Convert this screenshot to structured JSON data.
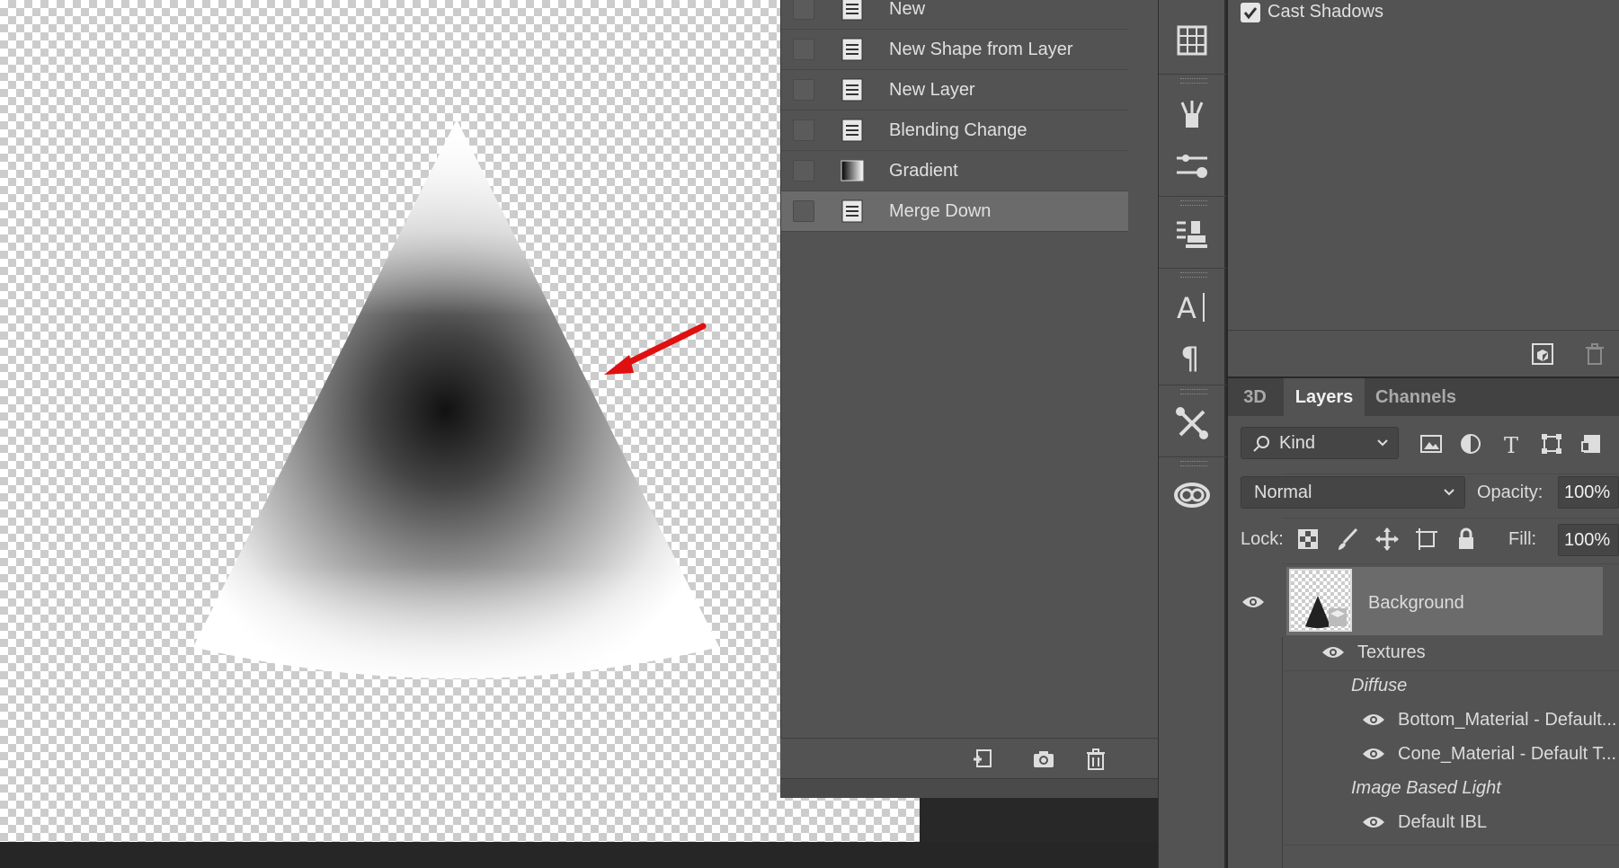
{
  "history": {
    "items": [
      {
        "label": "New",
        "icon": "document-icon",
        "selected": false
      },
      {
        "label": "New Shape from Layer",
        "icon": "document-icon",
        "selected": false
      },
      {
        "label": "New Layer",
        "icon": "document-icon",
        "selected": false
      },
      {
        "label": "Blending Change",
        "icon": "document-icon",
        "selected": false
      },
      {
        "label": "Gradient",
        "icon": "gradient-icon",
        "selected": false
      },
      {
        "label": "Merge Down",
        "icon": "document-icon",
        "selected": true
      }
    ]
  },
  "properties": {
    "cast_shadows_label": "Cast Shadows",
    "cast_shadows_checked": true
  },
  "layers_panel": {
    "tabs": [
      {
        "label": "3D",
        "active": false
      },
      {
        "label": "Layers",
        "active": true
      },
      {
        "label": "Channels",
        "active": false
      }
    ],
    "filter_kind": "Kind",
    "blend_mode": "Normal",
    "opacity_label": "Opacity:",
    "opacity_value": "100%",
    "lock_label": "Lock:",
    "fill_label": "Fill:",
    "fill_value": "100%",
    "layer_name": "Background",
    "textures_label": "Textures",
    "diffuse_label": "Diffuse",
    "diffuse_items": [
      "Bottom_Material - Default...",
      "Cone_Material - Default T..."
    ],
    "ibl_label": "Image Based Light",
    "ibl_item": "Default IBL"
  },
  "colors": {
    "panel_bg": "#535353",
    "selected_row": "#6b6b6b",
    "arrow": "#e01010"
  }
}
